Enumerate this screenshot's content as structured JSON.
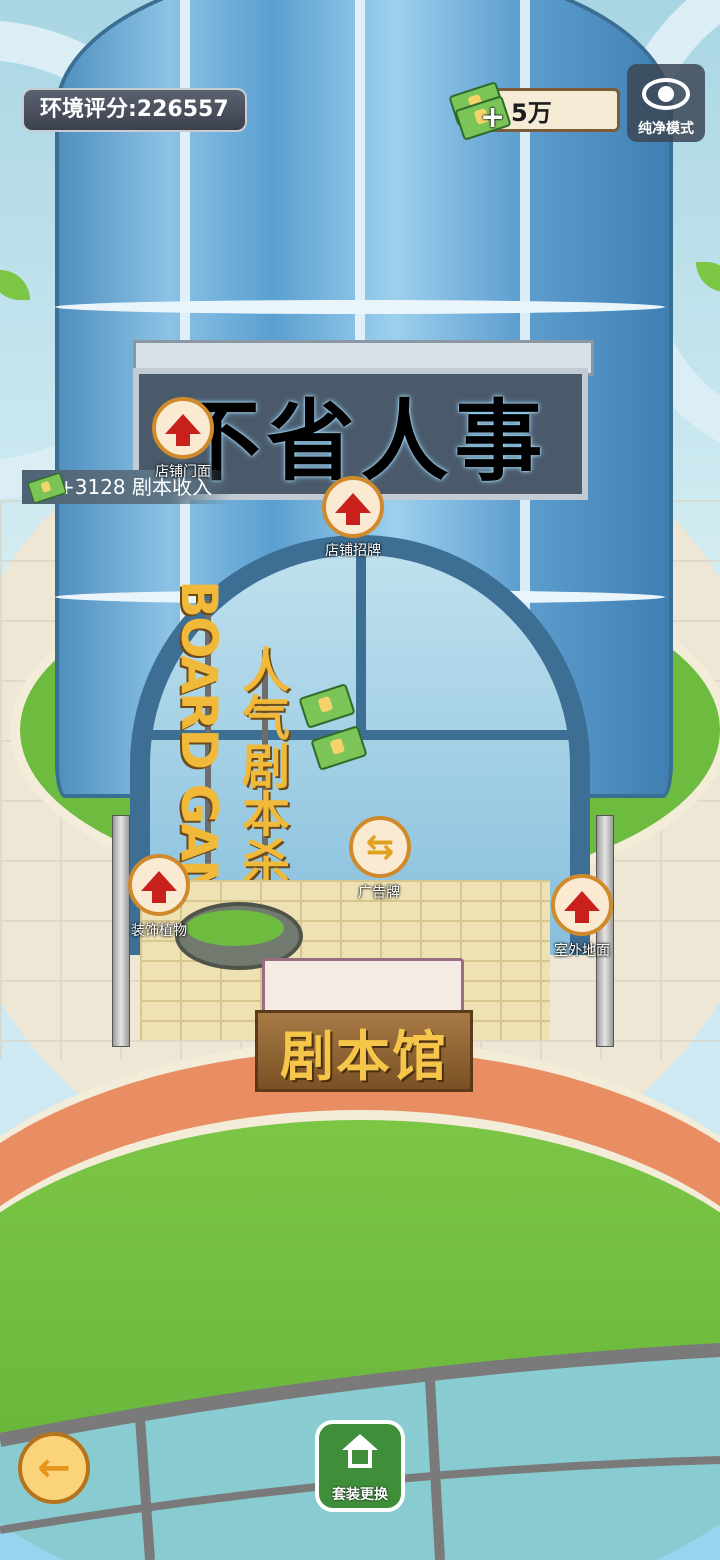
{
  "hud": {
    "score_label": "环境评分:226557",
    "money_value": "5万",
    "money_plus": "+",
    "view_mode_label": "纯净模式"
  },
  "income_toast": {
    "text": "+3128   剧本收入"
  },
  "store": {
    "sign_text": "不省人事",
    "vertical_sign_en": "BOARD GAME",
    "vertical_sign_cn": "人气剧本杀",
    "plaque_text": "剧本馆"
  },
  "upgrade_points": [
    {
      "label": "店铺门面",
      "type": "upgrade"
    },
    {
      "label": "店铺招牌",
      "type": "upgrade"
    },
    {
      "label": "广告牌",
      "type": "swap"
    },
    {
      "label": "装饰植物",
      "type": "upgrade"
    },
    {
      "label": "室外地面",
      "type": "upgrade"
    }
  ],
  "bottom": {
    "back_icon": "←",
    "swap_icon": "⇆",
    "suit_label": "套装更换"
  }
}
